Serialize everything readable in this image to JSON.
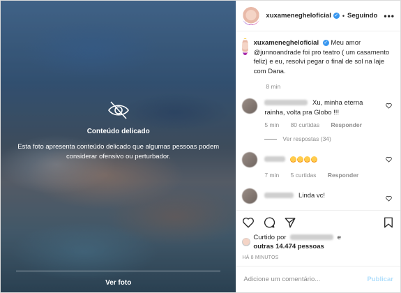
{
  "media": {
    "sensitive_title": "Conteúdo delicado",
    "sensitive_text": "Esta foto apresenta conteúdo delicado que algumas pessoas podem considerar ofensivo ou perturbador.",
    "view_photo_label": "Ver foto"
  },
  "header": {
    "username": "xuxameneghelоficial",
    "follow_status": "Seguindo",
    "separator": "•"
  },
  "caption": {
    "username": "xuxameneghelоficial",
    "text": "Meu amor @junnoandrade foi pro teatro ( um casamento feliz) e eu, resolvi pegar o final de sol na laje com Dana.",
    "time": "8 min"
  },
  "comments": [
    {
      "text": "Xu, minha eterna rainha, volta pra Globo !!!",
      "time": "5 min",
      "likes": "80 curtidas",
      "reply": "Responder",
      "replies": "Ver respostas (34)"
    },
    {
      "text": "",
      "emoji_count": 4,
      "time": "7 min",
      "likes": "5 curtidas",
      "reply": "Responder"
    },
    {
      "text": "Linda vc!"
    }
  ],
  "likes": {
    "prefix": "Curtido por",
    "suffix": "e",
    "others": "outras 14.474 pessoas"
  },
  "timestamp": "HÁ 8 MINUTOS",
  "add_comment": {
    "placeholder": "Adicione um comentário...",
    "publish_label": "Publicar"
  },
  "colors": {
    "accent": "#3897f0",
    "muted": "#8e8e8e",
    "publish_disabled": "#b2dffc"
  }
}
